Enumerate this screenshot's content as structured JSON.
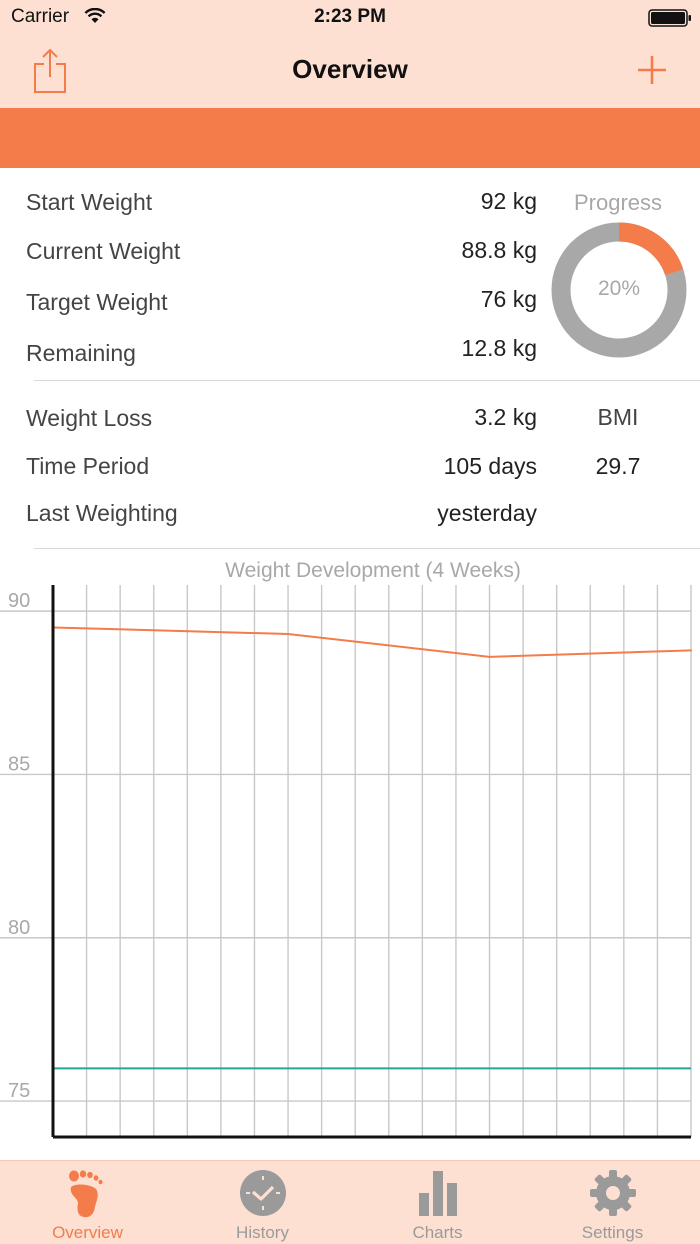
{
  "status_bar": {
    "carrier": "Carrier",
    "time": "2:23 PM"
  },
  "nav": {
    "title": "Overview",
    "share_icon": "share-icon",
    "add_icon": "plus-icon"
  },
  "colors": {
    "accent": "#f47b4a",
    "header_bg": "#fde0d2",
    "goal_line": "#26a69a",
    "muted": "#a8a8a8"
  },
  "stats": [
    {
      "label": "Start Weight",
      "value": "92 kg"
    },
    {
      "label": "Current Weight",
      "value": "88.8 kg"
    },
    {
      "label": "Target Weight",
      "value": "76 kg"
    },
    {
      "label": "Remaining",
      "value": "12.8 kg"
    }
  ],
  "progress": {
    "label": "Progress",
    "percent_text": "20%",
    "fraction": 0.2
  },
  "details": [
    {
      "label": "Weight Loss",
      "value": "3.2 kg"
    },
    {
      "label": "Time Period",
      "value": "105 days"
    },
    {
      "label": "Last Weighting",
      "value": "yesterday"
    }
  ],
  "bmi": {
    "label": "BMI",
    "value": "29.7"
  },
  "chart_data": {
    "type": "line",
    "title": "Weight Development (4 Weeks)",
    "xlabel": "",
    "ylabel": "",
    "ylim": [
      73.9,
      90.8
    ],
    "yticks": [
      90,
      85,
      80,
      75
    ],
    "x": [
      0,
      7,
      13,
      19
    ],
    "xlim": [
      0,
      19
    ],
    "x_grid_count": 19,
    "grid": true,
    "series": [
      {
        "values": [
          89.5,
          89.3,
          88.6,
          88.8
        ],
        "color": "#f47b4a"
      }
    ],
    "reference_line": {
      "y": 76,
      "color": "#26a69a"
    }
  },
  "tabs": [
    {
      "label": "Overview",
      "icon": "footprint-icon",
      "active": true
    },
    {
      "label": "History",
      "icon": "clock-icon",
      "active": false
    },
    {
      "label": "Charts",
      "icon": "bar-chart-icon",
      "active": false
    },
    {
      "label": "Settings",
      "icon": "gear-icon",
      "active": false
    }
  ]
}
